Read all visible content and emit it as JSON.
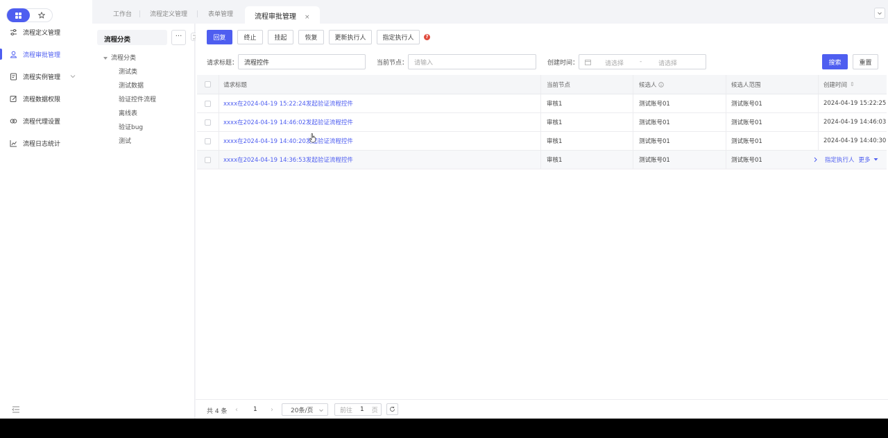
{
  "nav": {
    "items": [
      {
        "label": "流程定义管理",
        "icon": "sliders-icon"
      },
      {
        "label": "流程审批管理",
        "icon": "user-approve-icon",
        "active": true
      },
      {
        "label": "流程实例管理",
        "icon": "instance-icon"
      },
      {
        "label": "流程数据权限",
        "icon": "edit-square-icon"
      },
      {
        "label": "流程代理设置",
        "icon": "proxy-icon"
      },
      {
        "label": "流程日志统计",
        "icon": "chart-icon"
      }
    ]
  },
  "tabs": [
    {
      "label": "工作台"
    },
    {
      "label": "流程定义管理"
    },
    {
      "label": "表单管理"
    },
    {
      "label": "流程审批管理",
      "active": true,
      "close": "×"
    }
  ],
  "category": {
    "title": "流程分类",
    "more": "···",
    "root": "流程分类",
    "children": [
      "测试类",
      "测试数据",
      "验证控件流程",
      "离线表",
      "验证bug",
      "测试"
    ]
  },
  "toolbar": {
    "buttons": [
      "回复",
      "终止",
      "挂起",
      "恢复",
      "更新执行人",
      "指定执行人"
    ]
  },
  "filters": {
    "title_label": "请求标题：",
    "title_value": "流程控件",
    "node_label": "当前节点：",
    "node_placeholder": "请输入",
    "time_label": "创建时间：",
    "start_placeholder": "请选择",
    "range_sep": "-",
    "end_placeholder": "请选择",
    "search": "搜索",
    "reset": "重置"
  },
  "table": {
    "headers": [
      "请求标题",
      "当前节点",
      "候选人",
      "候选人范围",
      "创建时间"
    ],
    "sort_glyph": "⇕",
    "rows": [
      {
        "title": "xxxx在2024-04-19 15:22:24发起验证流程控件",
        "node": "审核1",
        "candidate": "测试账号01",
        "range": "测试账号01",
        "time": "2024-04-19 15:22:25"
      },
      {
        "title": "xxxx在2024-04-19 14:46:02发起验证流程控件",
        "node": "审核1",
        "candidate": "测试账号01",
        "range": "测试账号01",
        "time": "2024-04-19 14:46:03"
      },
      {
        "title": "xxxx在2024-04-19 14:40:20发起验证流程控件",
        "node": "审核1",
        "candidate": "测试账号01",
        "range": "测试账号01",
        "time": "2024-04-19 14:40:30"
      },
      {
        "title": "xxxx在2024-04-19 14:36:53发起验证流程控件",
        "node": "审核1",
        "candidate": "测试账号01",
        "range": "测试账号01",
        "time": ""
      }
    ],
    "hover_actions": {
      "assign": "指定执行人",
      "more": "更多"
    }
  },
  "pager": {
    "total": "共 4 条",
    "page": "1",
    "size": "20条/页",
    "goto_label": "前往",
    "goto_value": "1",
    "page_unit": "页"
  },
  "colors": {
    "primary": "#4e5ef0",
    "danger": "#e04a3c"
  }
}
